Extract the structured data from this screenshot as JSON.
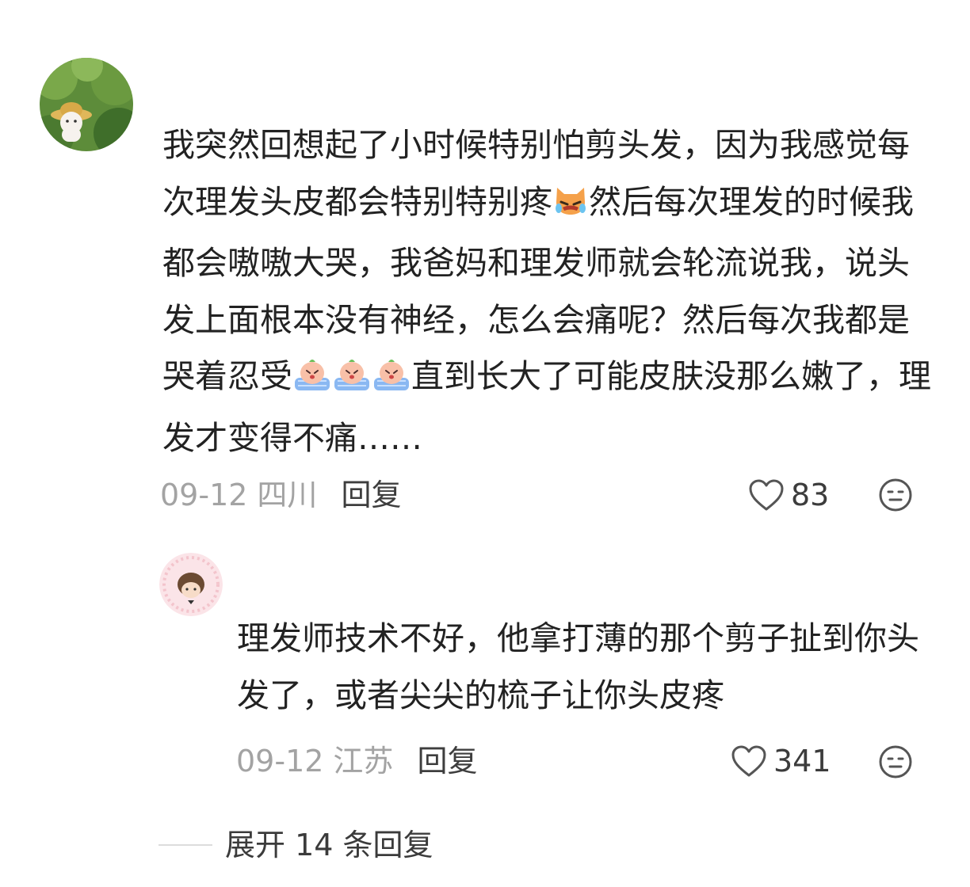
{
  "comments": [
    {
      "username": "",
      "text_segments": [
        "我突然回想起了小时候特别怕剪头发，因为我感觉每次理发头皮都会特别特别疼",
        "然后每次理发的时候我都会嗷嗷大哭，我爸妈和理发师就会轮流说我，说头发上面根本没有神经，怎么会痛呢？然后每次我都是哭着忍受",
        "直到长大了可能皮肤没那么嫩了，理发才变得不痛……"
      ],
      "emojis": [
        "angry-cat-emoji",
        "crying-peach-emoji",
        "crying-peach-emoji",
        "crying-peach-emoji"
      ],
      "date": "09-12",
      "location": "四川",
      "reply_label": "回复",
      "like_count": "83"
    },
    {
      "username": "",
      "text": "理发师技术不好，他拿打薄的那个剪子扯到你头发了，或者尖尖的梳子让你头皮疼",
      "date": "09-12",
      "location": "江苏",
      "reply_label": "回复",
      "like_count": "341"
    }
  ],
  "expand_replies_label": "展开 14 条回复",
  "colors": {
    "text": "#222222",
    "meta": "#a3a3a3",
    "reply": "#3e3e3e",
    "icon": "#555555"
  }
}
